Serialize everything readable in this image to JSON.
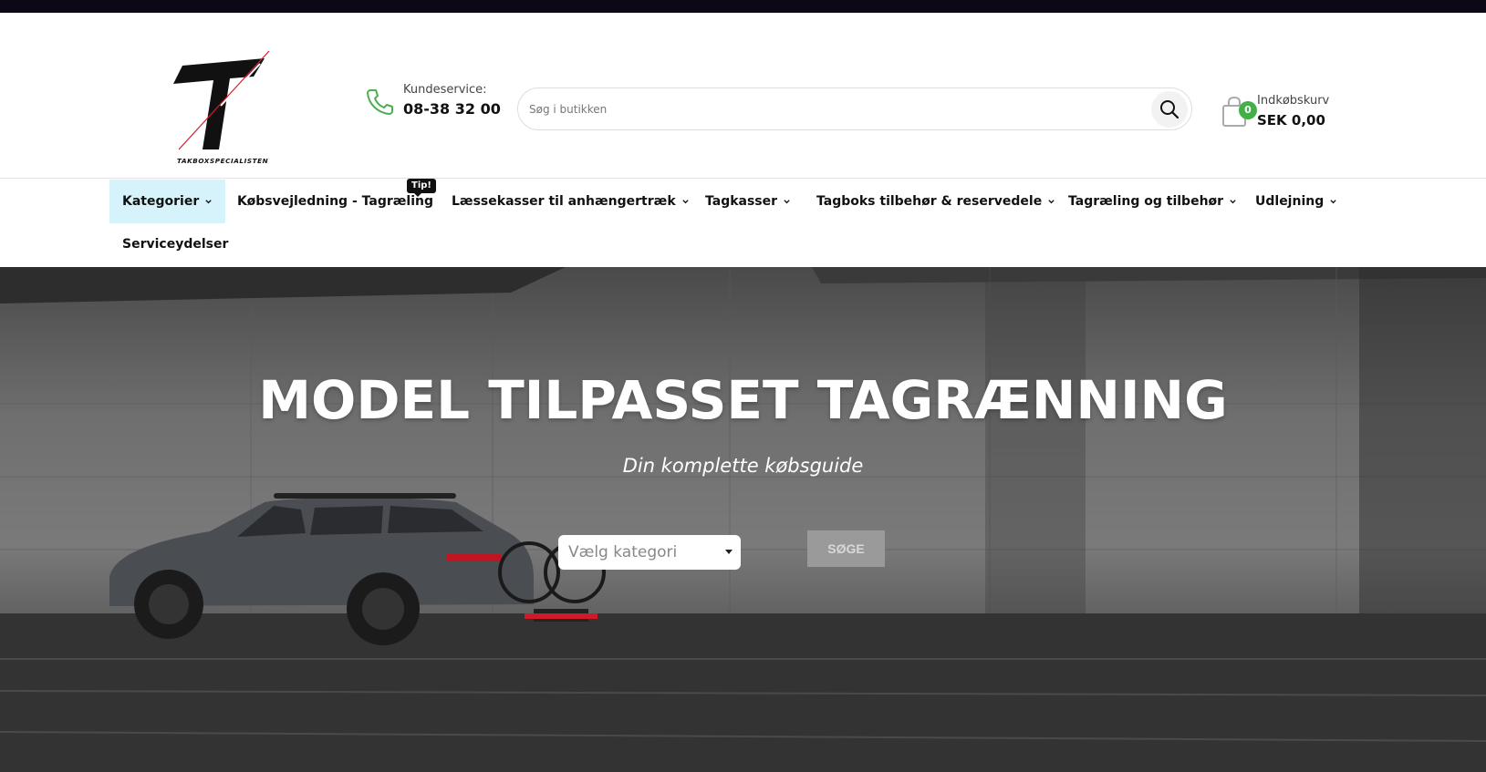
{
  "header": {
    "logo_text": "TAKBOXSPECIALISTEN",
    "customer_service": {
      "label": "Kundeservice:",
      "phone": "08-38 32 00",
      "icon": "phone-icon"
    },
    "search": {
      "placeholder": "Søg i butikken",
      "value": "",
      "icon": "search-icon"
    },
    "cart": {
      "label": "Indkøbskurv",
      "total": "SEK 0,00",
      "count": "0",
      "icon": "shopping-bag-icon"
    }
  },
  "nav": {
    "items": [
      {
        "label": "Kategorier",
        "has_dropdown": true,
        "active": true
      },
      {
        "label": "Købsvejledning - Tagræling",
        "has_dropdown": false,
        "badge": "Tip!"
      },
      {
        "label": "Læssekasser til anhængertræk",
        "has_dropdown": true
      },
      {
        "label": "Tagkasser",
        "has_dropdown": true
      },
      {
        "label": "Tagboks tilbehør & reservedele",
        "has_dropdown": true
      },
      {
        "label": "Tagræling og tilbehør",
        "has_dropdown": true
      },
      {
        "label": "Udlejning",
        "has_dropdown": true
      },
      {
        "label": "Serviceydelser",
        "has_dropdown": false
      }
    ]
  },
  "hero": {
    "title": "MODEL TILPASSET TAGRÆNNING",
    "subtitle": "Din komplette købsguide",
    "select": {
      "selected": "Vælg kategori"
    },
    "submit_label": "SØGE"
  },
  "colors": {
    "topbar": "#0d0818",
    "active_nav_bg": "#d6f2fb",
    "cart_badge": "#43b047",
    "phone_icon": "#4caf50"
  }
}
